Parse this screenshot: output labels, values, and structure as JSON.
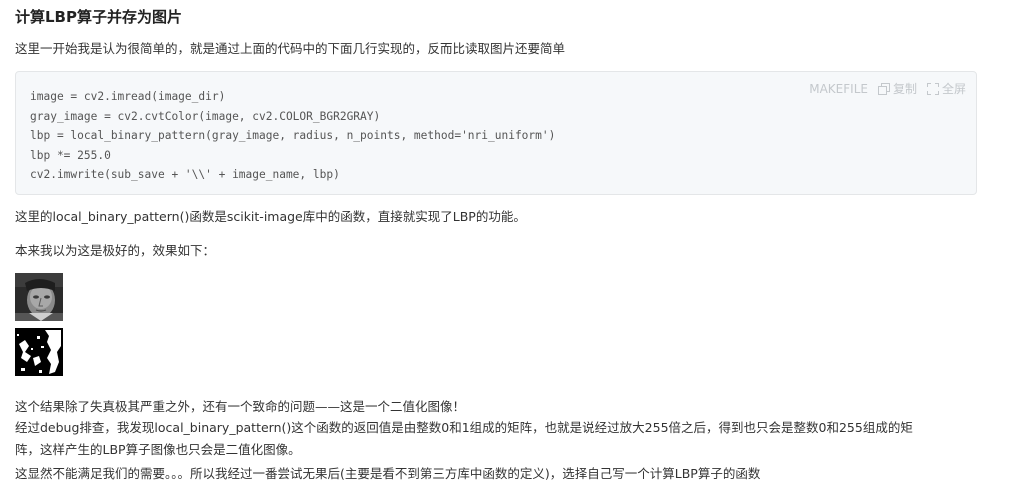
{
  "title": "计算LBP算子并存为图片",
  "intro": "这里一开始我是认为很简单的，就是通过上面的代码中的下面几行实现的，反而比读取图片还要简单",
  "code_block": {
    "language": "MAKEFILE",
    "copy_label": "复制",
    "fullscreen_label": "全屏",
    "lines": [
      "image = cv2.imread(image_dir)",
      "gray_image = cv2.cvtColor(image, cv2.COLOR_BGR2GRAY)",
      "lbp = local_binary_pattern(gray_image, radius, n_points, method='nri_uniform')",
      "lbp *= 255.0",
      "cv2.imwrite(sub_save + '\\\\' + image_name, lbp)"
    ]
  },
  "para_lib": "这里的local_binary_pattern()函数是scikit-image库中的函数，直接就实现了LBP的功能。",
  "para_effect": "本来我以为这是极好的，效果如下：",
  "para_result": "这个结果除了失真极其严重之外，还有一个致命的问题——这是一个二值化图像！",
  "para_debug_1": "经过debug排查，我发现local_binary_pattern()这个函数的返回值是由整数0和1组成的矩阵，也就是说经过放大255倍之后，得到也只会是整数0和255组成的矩",
  "para_debug_2": "阵，这样产生的LBP算子图像也只会是二值化图像。",
  "para_conclusion": "这显然不能满足我们的需要。。。所以我经过一番尝试无果后(主要是看不到第三方库中函数的定义)，选择自己写一个计算LBP算子的函数",
  "colors": {
    "text": "#333333",
    "code_bg": "#f6f8fa",
    "code_text": "#555555",
    "toolbar": "#c4c8cc"
  }
}
